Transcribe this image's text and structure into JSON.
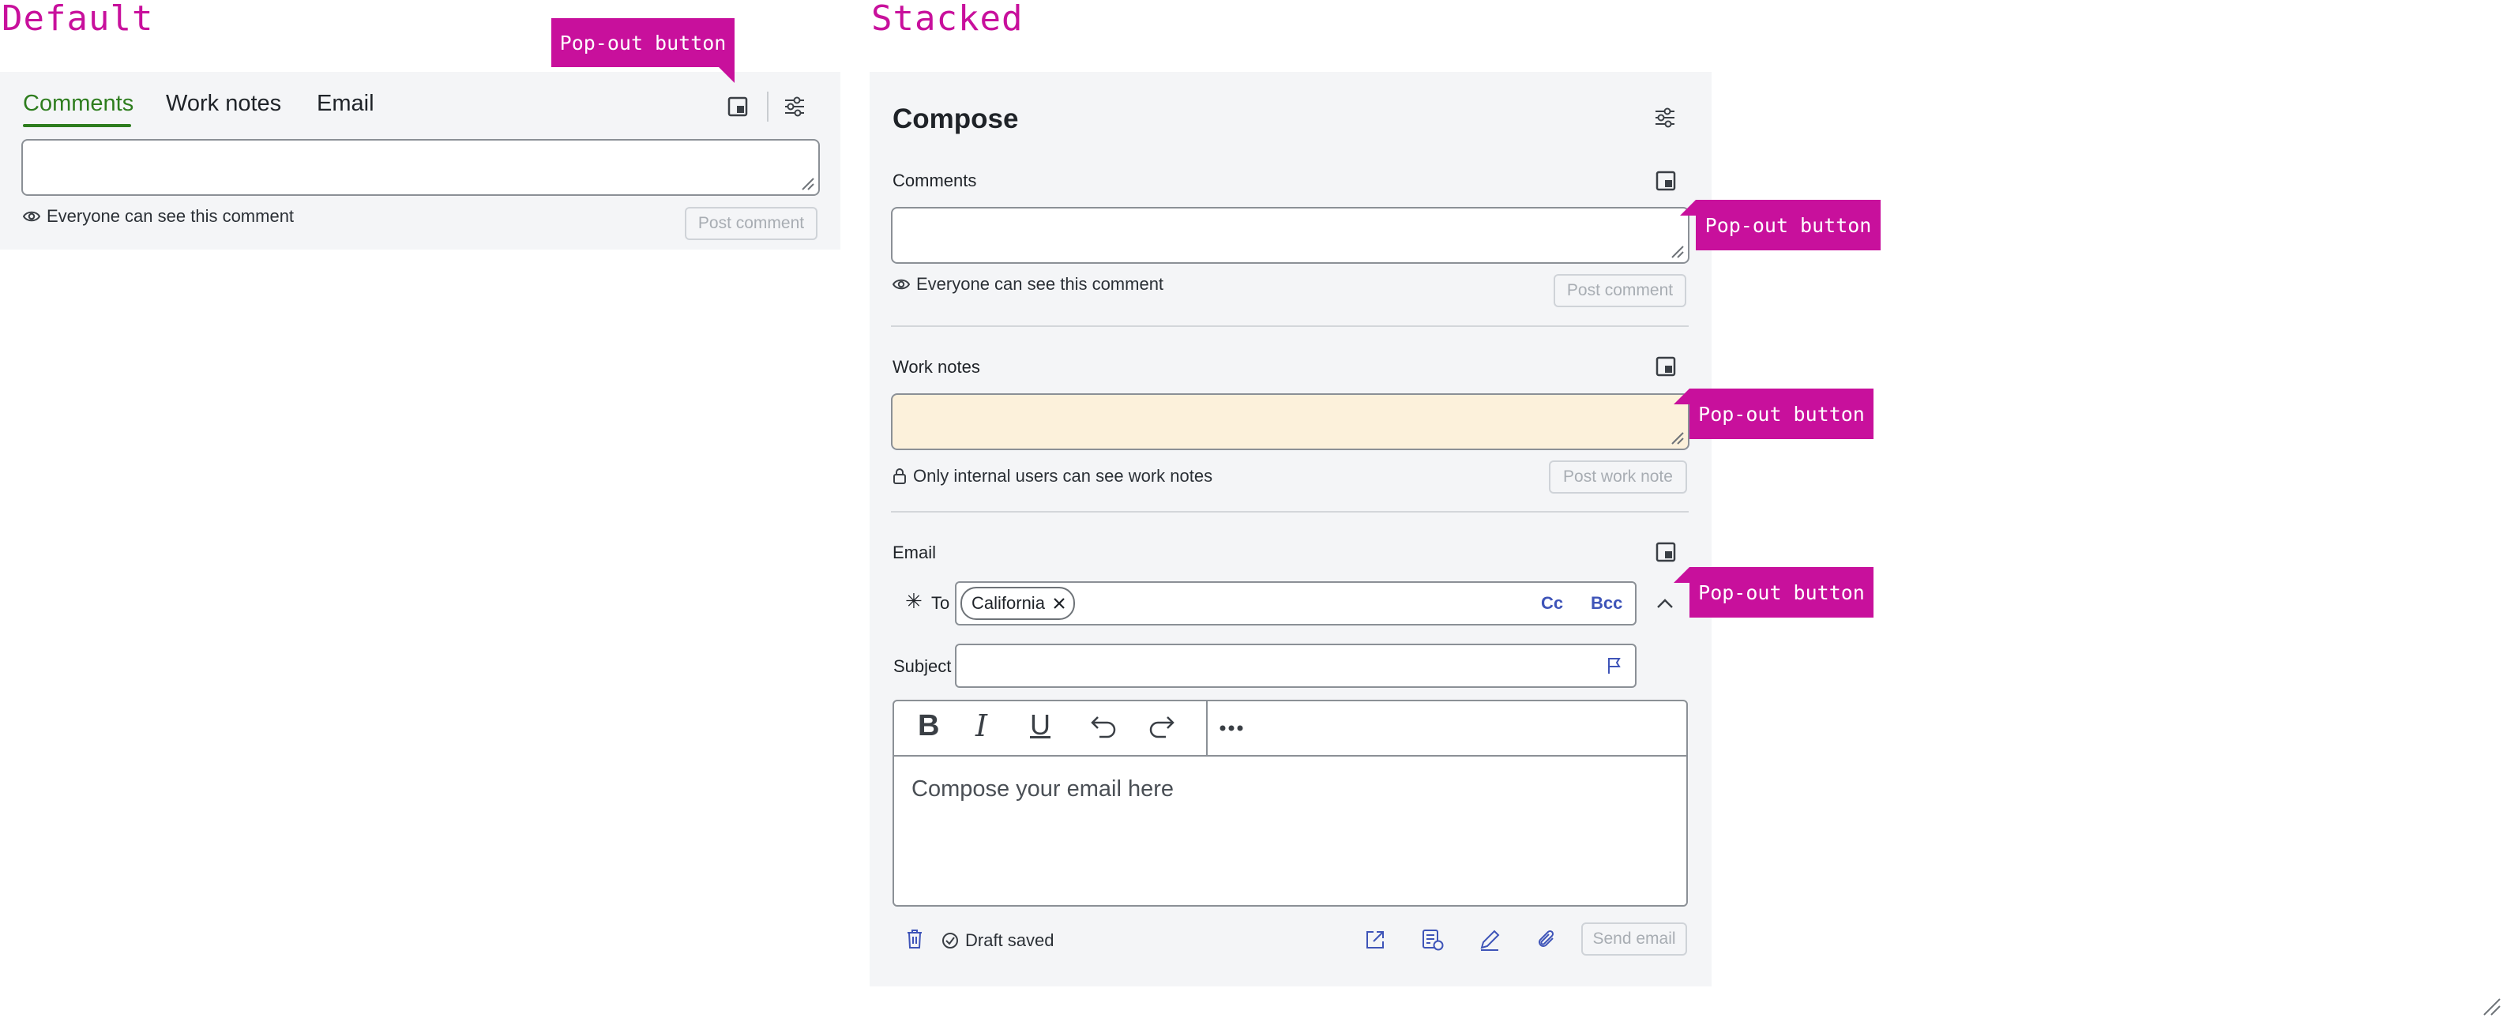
{
  "headings": {
    "default": "Default",
    "stacked": "Stacked"
  },
  "callouts": {
    "popout": "Pop-out button"
  },
  "default_panel": {
    "tabs": [
      "Comments",
      "Work notes",
      "Email"
    ],
    "active_tab": "Comments",
    "visibility_hint": "Everyone can see this comment",
    "post_button": "Post comment"
  },
  "stacked_panel": {
    "title": "Compose",
    "comments": {
      "label": "Comments",
      "hint": "Everyone can see this comment",
      "post_button": "Post comment"
    },
    "work_notes": {
      "label": "Work notes",
      "hint": "Only internal users can see work notes",
      "post_button": "Post work note",
      "field_color": "#fcf1db"
    },
    "email": {
      "label": "Email",
      "to_label": "To",
      "recipient": "California",
      "cc": "Cc",
      "bcc": "Bcc",
      "subject_label": "Subject",
      "editor_placeholder": "Compose your email here",
      "draft_status": "Draft saved",
      "send_button": "Send email"
    }
  },
  "colors": {
    "accent": "#c8109c",
    "active_tab": "#2e7d1e",
    "link": "#3e54b8",
    "panel": "#f4f5f7"
  }
}
